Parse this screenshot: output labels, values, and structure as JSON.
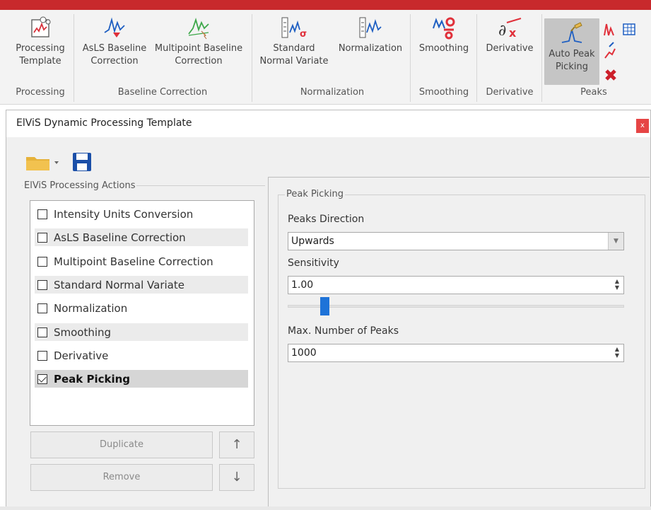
{
  "ribbon": {
    "buttons": {
      "processing_template": [
        "Processing",
        "Template"
      ],
      "asls": [
        "AsLS Baseline",
        "Correction"
      ],
      "multipoint": [
        "Multipoint Baseline",
        "Correction"
      ],
      "snv": [
        "Standard",
        "Normal Variate"
      ],
      "normalization": [
        "Normalization"
      ],
      "smoothing": [
        "Smoothing"
      ],
      "derivative": [
        "Derivative"
      ],
      "auto_peak": [
        "Auto Peak",
        "Picking"
      ]
    },
    "groups": {
      "processing": "Processing",
      "baseline": "Baseline Correction",
      "normalization": "Normalization",
      "smoothing": "Smoothing",
      "derivative": "Derivative",
      "peaks": "Peaks"
    }
  },
  "dialog": {
    "title": "ElViS Dynamic Processing Template",
    "close": "x",
    "actions_label": "ElViS Processing Actions",
    "actions": [
      {
        "label": "Intensity Units Conversion",
        "checked": false
      },
      {
        "label": "AsLS Baseline Correction",
        "checked": false
      },
      {
        "label": "Multipoint Baseline Correction",
        "checked": false
      },
      {
        "label": "Standard Normal Variate",
        "checked": false
      },
      {
        "label": "Normalization",
        "checked": false
      },
      {
        "label": "Smoothing",
        "checked": false
      },
      {
        "label": "Derivative",
        "checked": false
      },
      {
        "label": "Peak Picking",
        "checked": true
      }
    ],
    "duplicate_label": "Duplicate",
    "remove_label": "Remove",
    "up_arrow": "↑",
    "down_arrow": "↓",
    "peak_group_label": "Peak Picking",
    "peaks_direction_label": "Peaks Direction",
    "peaks_direction_value": "Upwards",
    "sensitivity_label": "Sensitivity",
    "sensitivity_value": "1.00",
    "max_peaks_label": "Max. Number of Peaks",
    "max_peaks_value": "1000"
  },
  "colors": {
    "menubar": "#c8292c",
    "accent_blue": "#1e73d8",
    "icon_red": "#e0303a",
    "icon_green": "#3da84a"
  }
}
